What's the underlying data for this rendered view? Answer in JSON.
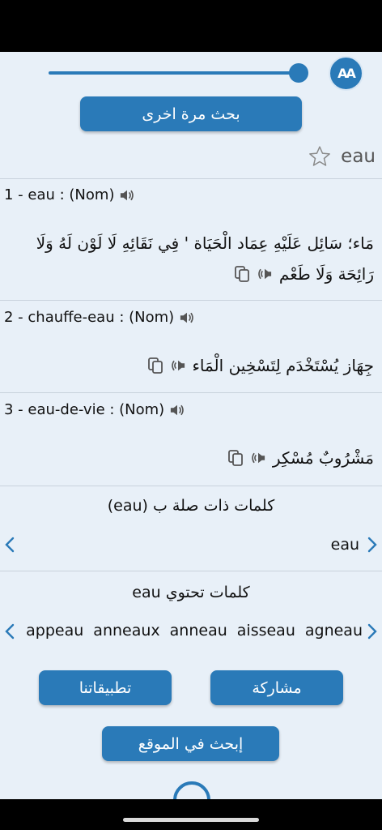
{
  "toolbar": {
    "font_size_button_label": "AA",
    "font_size_level": 1.0
  },
  "search_again_label": "بحث مرة اخرى",
  "headword": "eau",
  "entries": [
    {
      "title": "1 - eau : (Nom)",
      "arabic_line1": "مَاء؛ سَائِل عَلَيْهِ عِمَاد الْحَيَاة ' فِي نَقَائِهِ لَا لَوْن لَهُ وَلَا",
      "arabic_line2": "رَائِحَة وَلَا طَعْم"
    },
    {
      "title": "2 - chauffe-eau : (Nom)",
      "arabic_line1": "جِهَاز يُسْتَخْدَم لِتَسْخِين الْمَاء"
    },
    {
      "title": "3 - eau-de-vie : (Nom)",
      "arabic_line1": "مَشْرُوبٌ مُسْكِر"
    }
  ],
  "related": {
    "title": "كلمات ذات صلة ب (eau)",
    "current_word": "eau"
  },
  "containing": {
    "title": "كلمات تحتوي eau",
    "words": [
      "agneau",
      "aisseau",
      "anneau",
      "anneaux",
      "appeau"
    ]
  },
  "buttons": {
    "apps": "تطبيقاتنا",
    "share": "مشاركة",
    "search_site": "إبحث في الموقع"
  },
  "colors": {
    "accent": "#2a7ab8",
    "background": "#e8f0f8"
  }
}
